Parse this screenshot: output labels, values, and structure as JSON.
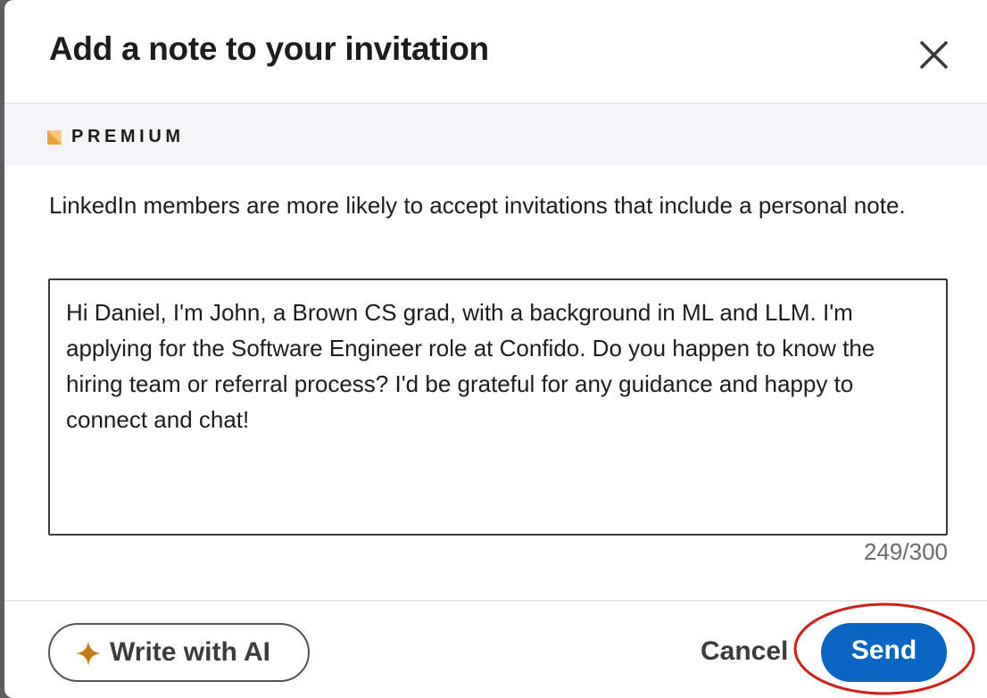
{
  "dialog": {
    "title": "Add a note to your invitation",
    "close_icon": "close-icon"
  },
  "premium": {
    "label": "PREMIUM",
    "logo_icon": "premium-logo-icon",
    "logo_color": "#e7a33e"
  },
  "description": "LinkedIn members are more likely to accept invitations that include a personal note.",
  "note": {
    "value": "Hi Daniel, I'm John, a Brown CS grad, with a background in ML and LLM. I'm applying for the Software Engineer role at Confido. Do you happen to know the hiring team or referral process? I'd be grateful for any guidance and happy to connect and chat!",
    "counter": "249/300"
  },
  "footer": {
    "ai_button_label": "Write with AI",
    "ai_icon": "sparkle-icon",
    "ai_icon_color": "#c37d16",
    "cancel_label": "Cancel",
    "send_label": "Send",
    "send_color": "#0a66c2",
    "highlight_color": "#d0201a"
  }
}
